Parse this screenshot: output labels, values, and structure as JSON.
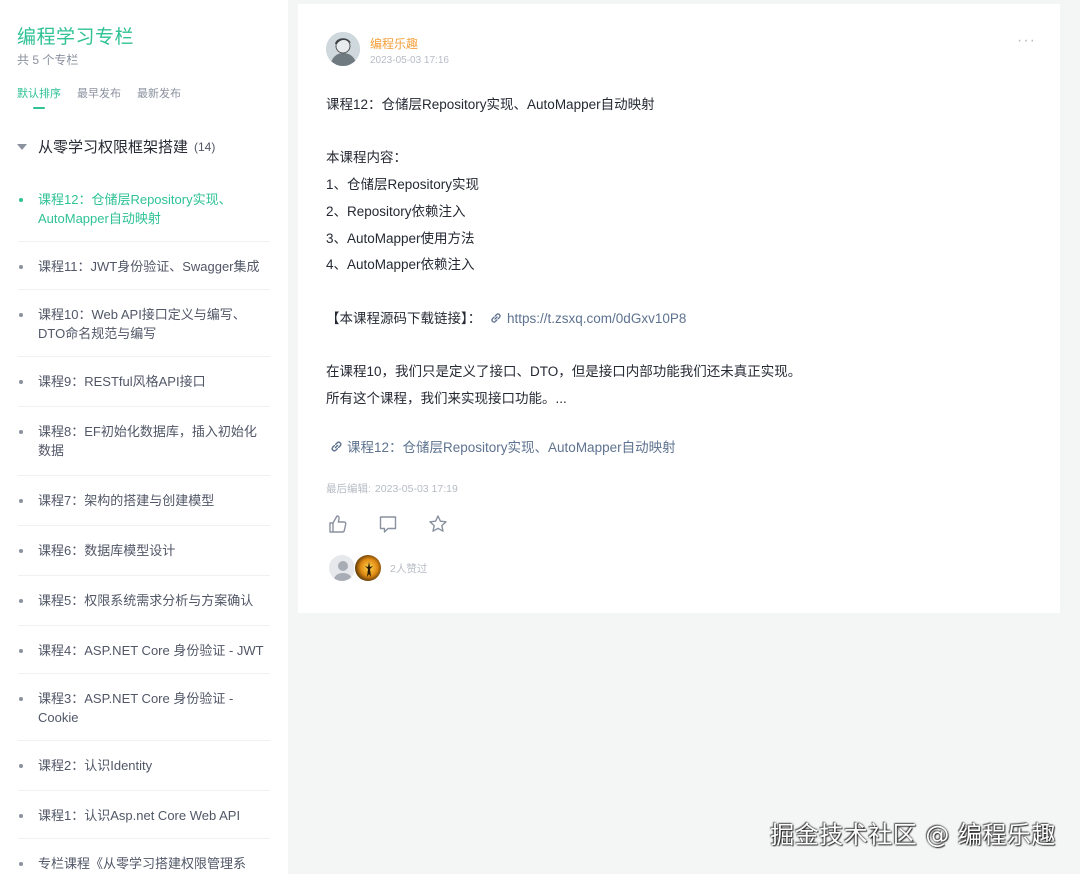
{
  "sidebar": {
    "title": "编程学习专栏",
    "subtitle": "共 5 个专栏",
    "sort_tabs": [
      {
        "label": "默认排序",
        "active": true
      },
      {
        "label": "最早发布",
        "active": false
      },
      {
        "label": "最新发布",
        "active": false
      }
    ],
    "group": {
      "name": "从零学习权限框架搭建",
      "count": "(14)"
    },
    "lessons": [
      {
        "label": "课程12：仓储层Repository实现、AutoMapper自动映射",
        "active": true
      },
      {
        "label": "课程11：JWT身份验证、Swagger集成"
      },
      {
        "label": "课程10：Web API接口定义与编写、DTO命名规范与编写"
      },
      {
        "label": "课程9：RESTful风格API接口"
      },
      {
        "label": "课程8：EF初始化数据库，插入初始化数据"
      },
      {
        "label": "课程7：架构的搭建与创建模型"
      },
      {
        "label": "课程6：数据库模型设计"
      },
      {
        "label": "课程5：权限系统需求分析与方案确认"
      },
      {
        "label": "课程4：ASP.NET Core 身份验证 - JWT"
      },
      {
        "label": "课程3：ASP.NET Core 身份验证 - Cookie"
      },
      {
        "label": "课程2：认识Identity"
      },
      {
        "label": "课程1：认识Asp.net Core Web API"
      },
      {
        "label": "专栏课程《从零学习搭建权限管理系"
      }
    ]
  },
  "post": {
    "author": "编程乐趣",
    "time": "2023-05-03 17:16",
    "more": "···",
    "lines": {
      "title": "课程12：仓储层Repository实现、AutoMapper自动映射",
      "intro": "本课程内容：",
      "item1": "1、仓储层Repository实现",
      "item2": "2、Repository依赖注入",
      "item3": "3、AutoMapper使用方法",
      "item4": "4、AutoMapper依赖注入",
      "source_label": "【本课程源码下载链接】：",
      "source_url": "https://t.zsxq.com/0dGxv10P8",
      "para1": "在课程10，我们只是定义了接口、DTO，但是接口内部功能我们还未真正实现。",
      "para2": "所有这个课程，我们来实现接口功能。..."
    },
    "link_text": "课程12：仓储层Repository实现、AutoMapper自动映射",
    "edited_label": "最后编辑:",
    "edited_time": "2023-05-03 17:19",
    "actions": [
      "like-icon",
      "comment-icon",
      "star-icon"
    ],
    "likes_text": "2人赞过"
  },
  "watermark": "掘金技术社区 @ 编程乐趣",
  "colors": {
    "accent": "#2fc295",
    "author": "#f5a03c",
    "link": "#5e7390",
    "muted": "#8a919f",
    "background": "#f4f5f5"
  }
}
